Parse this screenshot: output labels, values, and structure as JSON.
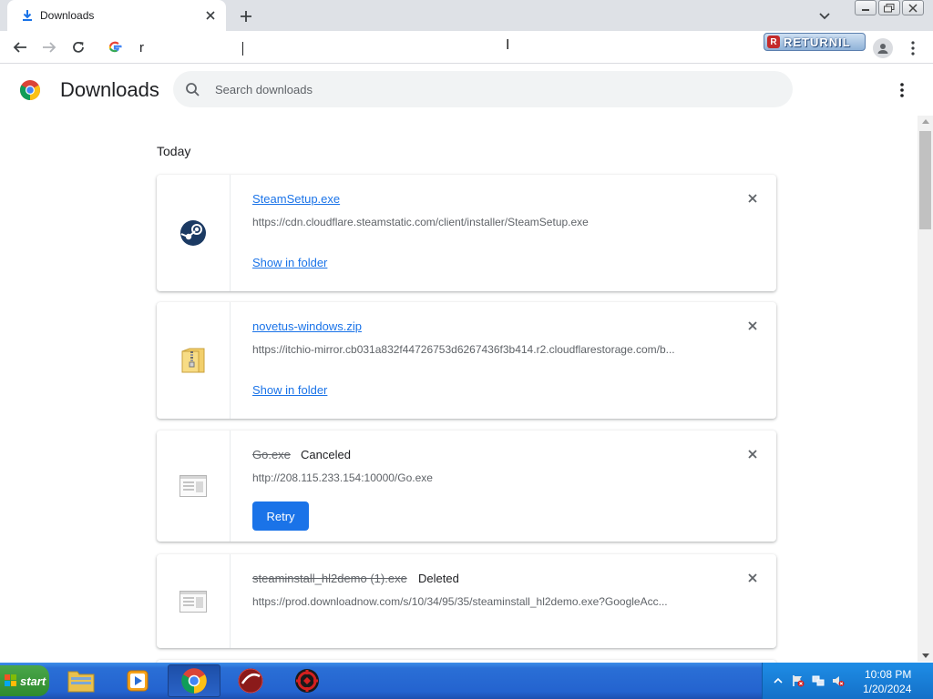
{
  "tab": {
    "title": "Downloads"
  },
  "omnibox": {
    "text": "r"
  },
  "extension": {
    "label": "RETURNIL",
    "logo_letter": "R"
  },
  "header": {
    "title": "Downloads",
    "search_placeholder": "Search downloads"
  },
  "section": {
    "label": "Today"
  },
  "downloads": [
    {
      "name": "SteamSetup.exe",
      "status": "",
      "url": "https://cdn.cloudflare.steamstatic.com/client/installer/SteamSetup.exe",
      "action": "Show in folder",
      "icon": "steam-icon"
    },
    {
      "name": "novetus-windows.zip",
      "status": "",
      "url": "https://itchio-mirror.cb031a832f44726753d6267436f3b414.r2.cloudflarestorage.com/b...",
      "action": "Show in folder",
      "icon": "zip-folder-icon"
    },
    {
      "name": "Go.exe",
      "status": "Canceled",
      "url": "http://208.115.233.154:10000/Go.exe",
      "action": "Retry",
      "icon": "generic-file-icon"
    },
    {
      "name": "steaminstall_hl2demo (1).exe",
      "status": "Deleted",
      "url": "https://prod.downloadnow.com/s/10/34/95/35/steaminstall_hl2demo.exe?GoogleAcc...",
      "action": "",
      "icon": "generic-file-icon"
    }
  ],
  "taskbar": {
    "start_label": "start",
    "clock_time": "10:08 PM",
    "clock_date": "1/20/2024"
  },
  "colors": {
    "accent": "#1a73e8",
    "taskbar": "#2463cf",
    "start": "#3a9a3a"
  }
}
